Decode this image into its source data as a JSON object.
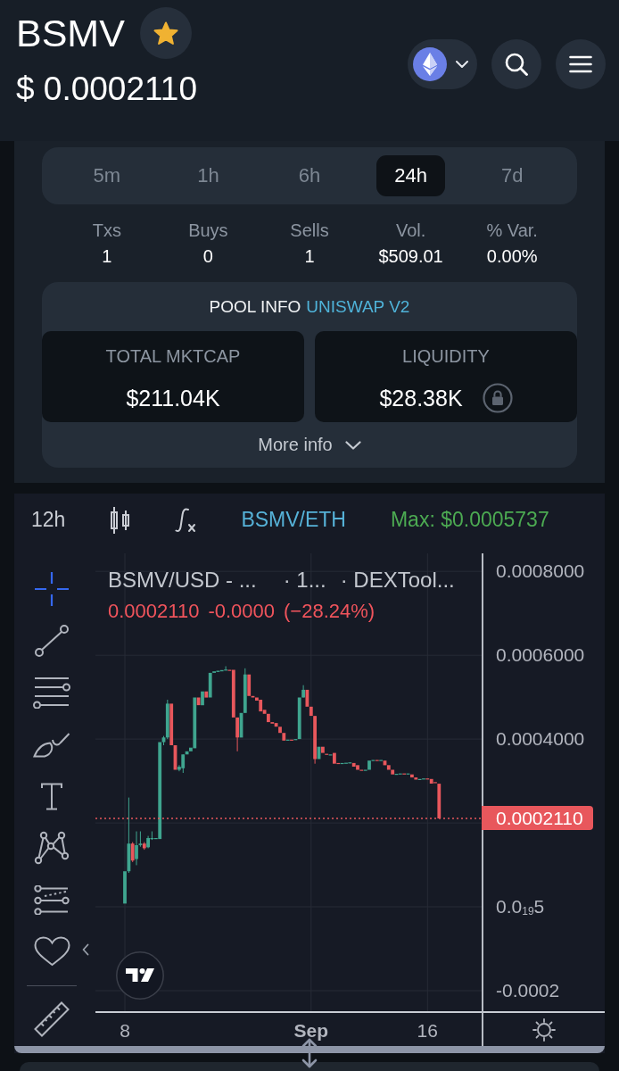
{
  "header": {
    "symbol": "BSMV",
    "starred": true,
    "price": "$ 0.0002110"
  },
  "timeframes": [
    {
      "label": "5m",
      "selected": false
    },
    {
      "label": "1h",
      "selected": false
    },
    {
      "label": "6h",
      "selected": false
    },
    {
      "label": "24h",
      "selected": true
    },
    {
      "label": "7d",
      "selected": false
    }
  ],
  "stats": [
    {
      "label": "Txs",
      "value": "1"
    },
    {
      "label": "Buys",
      "value": "0"
    },
    {
      "label": "Sells",
      "value": "1"
    },
    {
      "label": "Vol.",
      "value": "$509.01"
    },
    {
      "label": "% Var.",
      "value": "0.00%"
    }
  ],
  "pool_info": {
    "title": "POOL INFO",
    "exchange": "UNISWAP V2",
    "cards": [
      {
        "label": "TOTAL MKTCAP",
        "value": "$211.04K",
        "locked": false
      },
      {
        "label": "LIQUIDITY",
        "value": "$28.38K",
        "locked": true
      }
    ],
    "more_button": "More info"
  },
  "chart": {
    "interval": "12h",
    "pair": "BSMV/ETH",
    "max": "Max: $0.0005737",
    "tools": [
      {
        "selected": true
      },
      {
        "selected": false
      },
      {
        "selected": false
      },
      {
        "selected": false
      },
      {
        "selected": false
      },
      {
        "selected": false
      },
      {
        "selected": false
      },
      {
        "selected": false
      },
      {
        "selected": false
      }
    ],
    "legend": {
      "symbol": "BSMV/USD - ...",
      "interval": "· 1...",
      "source": "· DEXTool...",
      "last": "0.0002110",
      "change": "-0.0000",
      "change_percent": "(−28.24%)"
    },
    "zero_tick_label": "0.0$_{19}$5",
    "chart_data": {
      "type": "candlestick",
      "categories": [
        "8",
        null,
        null,
        null,
        null,
        null,
        null,
        null,
        null,
        null,
        null,
        null,
        null,
        null,
        null,
        null,
        null,
        null,
        null,
        null,
        null,
        null,
        null,
        null,
        null,
        null,
        null,
        null,
        null,
        null,
        null,
        null,
        null,
        null,
        null,
        null,
        null,
        null,
        null,
        null,
        null,
        null,
        null,
        null,
        null,
        null,
        null,
        null,
        "Sep",
        null,
        null,
        null,
        null,
        null,
        null,
        null,
        null,
        null,
        null,
        null,
        null,
        null,
        null,
        null,
        null,
        null,
        null,
        null,
        null,
        null,
        null,
        null,
        null,
        null,
        null,
        null,
        null,
        null,
        "16",
        null,
        null,
        null
      ],
      "ohlc": [
        [
          7.6e-06,
          8.47e-05,
          7.6e-06,
          8.47e-05
        ],
        [
          8.47e-05,
          0.0002607,
          8.1e-05,
          0.0001507
        ],
        [
          0.0001507,
          0.0001544,
          0.0001067,
          0.0001103
        ],
        [
          0.000114,
          0.00018,
          9.93e-05,
          0.000147
        ],
        [
          0.000147,
          0.00018,
          0.0001433,
          0.0001507
        ],
        [
          0.0001507,
          0.0001544,
          0.000136,
          0.0001397
        ],
        [
          0.0001419,
          0.000169,
          0.0001397,
          0.0001639
        ],
        [
          0.0001617,
          0.00018,
          0.0001595,
          0.0001639
        ],
        [
          0.0001624,
          0.0001639,
          0.0001624,
          0.0001639
        ],
        [
          0.0001617,
          0.0003928,
          0.0001617,
          0.0003928
        ],
        [
          0.0003928,
          0.0004075,
          0.0003854,
          0.0004038
        ],
        [
          0.0004038,
          0.000494,
          0.0004001,
          0.0004845
        ],
        [
          0.0004845,
          0.0004845,
          0.0003854,
          0.0003854
        ],
        [
          0.0003854,
          0.0003854,
          0.0003268,
          0.0003268
        ],
        [
          0.0003268,
          0.0003378,
          0.0003231,
          0.0003341
        ],
        [
          0.0003304,
          0.0003634,
          0.0003194,
          0.0003634
        ],
        [
          0.0003634,
          0.0003708,
          0.0003634,
          0.0003708
        ],
        [
          0.0003708,
          0.0003796,
          0.0003708,
          0.0003796
        ],
        [
          0.0003781,
          0.0004992,
          0.0003781,
          0.0004992
        ],
        [
          0.0004992,
          0.0004992,
          0.0004808,
          0.0004808
        ],
        [
          0.0004808,
          0.0005138,
          0.0004808,
          0.0005138
        ],
        [
          0.0005138,
          0.0005138,
          0.0004992,
          0.0004992
        ],
        [
          0.0004992,
          0.0005579,
          0.0004992,
          0.0005579
        ],
        [
          0.0005579,
          0.0005615,
          0.0005579,
          0.0005615
        ],
        [
          0.0005601,
          0.000563,
          0.0005601,
          0.000563
        ],
        [
          0.0005615,
          0.0005645,
          0.0005615,
          0.0005645
        ],
        [
          0.0005645,
          0.0005737,
          0.0005645,
          0.0005659
        ],
        [
          0.0005652,
          0.0005652,
          0.0005645,
          0.0005645
        ],
        [
          0.0005652,
          0.0005652,
          0.0004515,
          0.0004515
        ],
        [
          0.0004515,
          0.0004515,
          0.0003708,
          0.0004038
        ],
        [
          0.0004038,
          0.0004625,
          0.0004038,
          0.0004625
        ],
        [
          0.0004625,
          0.0005689,
          0.0004625,
          0.0005542
        ],
        [
          0.0005542,
          0.0005542,
          0.0005028,
          0.0005028
        ],
        [
          0.0005028,
          0.0005028,
          0.0004992,
          0.0004992
        ],
        [
          0.0004992,
          0.0004992,
          0.0004918,
          0.0004918
        ],
        [
          0.000494,
          0.000494,
          0.0004662,
          0.0004662
        ],
        [
          0.0004698,
          0.0004698,
          0.0004603,
          0.0004603
        ],
        [
          0.0004603,
          0.0004603,
          0.0004405,
          0.0004405
        ],
        [
          0.0004405,
          0.0004405,
          0.0004368,
          0.0004368
        ],
        [
          0.0004383,
          0.0004383,
          0.0004295,
          0.0004295
        ],
        [
          0.0004295,
          0.0004295,
          0.0004148,
          0.0004148
        ],
        [
          0.0004148,
          0.0004148,
          0.0003965,
          0.0003965
        ],
        [
          0.0003965,
          0.0003987,
          0.0003965,
          0.0003987
        ],
        [
          0.0003987,
          0.0003987,
          0.0003979,
          0.0003979
        ],
        [
          0.0003987,
          0.0004001,
          0.0003987,
          0.0004001
        ],
        [
          0.0004001,
          0.0004992,
          0.0004001,
          0.0004992
        ],
        [
          0.0004992,
          0.0005285,
          0.0004992,
          0.0005175
        ],
        [
          0.0005175,
          0.0005175,
          0.0004772,
          0.0004772
        ],
        [
          0.0004772,
          0.0004772,
          0.0004552,
          0.0004552
        ],
        [
          0.0004552,
          0.0004552,
          0.0003414,
          0.0003524
        ],
        [
          0.0003524,
          0.0003818,
          0.0003524,
          0.0003818
        ],
        [
          0.0003818,
          0.0003818,
          0.0003671,
          0.0003671
        ],
        [
          0.0003649,
          0.0003649,
          0.0003634,
          0.0003634
        ],
        [
          0.0003634,
          0.0003634,
          0.0003634,
          0.0003634
        ],
        [
          0.0003671,
          0.0003671,
          0.0003414,
          0.0003414
        ],
        [
          0.0003429,
          0.0003429,
          0.0003414,
          0.0003414
        ],
        [
          0.0003414,
          0.0003429,
          0.0003414,
          0.0003429
        ],
        [
          0.0003429,
          0.0003436,
          0.0003429,
          0.0003436
        ],
        [
          0.0003436,
          0.0003444,
          0.0003436,
          0.0003444
        ],
        [
          0.0003429,
          0.0003429,
          0.0003341,
          0.0003341
        ],
        [
          0.0003378,
          0.0003378,
          0.0003268,
          0.0003268
        ],
        [
          0.0003268,
          0.0003268,
          0.0003253,
          0.0003253
        ],
        [
          0.0003253,
          0.0003268,
          0.0003253,
          0.0003268
        ],
        [
          0.0003268,
          0.0003488,
          0.0003268,
          0.0003488
        ],
        [
          0.0003488,
          0.0003502,
          0.0003488,
          0.0003502
        ],
        [
          0.0003502,
          0.0003502,
          0.0003488,
          0.0003488
        ],
        [
          0.0003488,
          0.0003502,
          0.0003488,
          0.0003502
        ],
        [
          0.0003488,
          0.0003488,
          0.0003378,
          0.0003378
        ],
        [
          0.0003378,
          0.0003378,
          0.0003268,
          0.0003268
        ],
        [
          0.0003268,
          0.0003268,
          0.0003157,
          0.0003157
        ],
        [
          0.0003157,
          0.0003172,
          0.0003157,
          0.0003172
        ],
        [
          0.0003172,
          0.000318,
          0.0003172,
          0.000318
        ],
        [
          0.000318,
          0.000318,
          0.0003165,
          0.0003165
        ],
        [
          0.0003165,
          0.000318,
          0.0003165,
          0.000318
        ],
        [
          0.0003157,
          0.0003157,
          0.0003084,
          0.0003084
        ],
        [
          0.0003084,
          0.0003084,
          0.0003033,
          0.0003033
        ],
        [
          0.0003048,
          0.0003048,
          0.0003048,
          0.0003048
        ],
        [
          0.0003048,
          0.0003062,
          0.0003048,
          0.0003062
        ],
        [
          0.0003062,
          0.0003062,
          0.0003048,
          0.0003048
        ],
        [
          0.0003048,
          0.0003048,
          0.0002937,
          0.0002937
        ],
        [
          0.0002974,
          0.0002974,
          0.0002952,
          0.0002952
        ],
        [
          0.0002937,
          0.0002937,
          0.000211,
          0.000211
        ]
      ],
      "ylim": [
        -0.000249,
        0.000843
      ],
      "grid": true,
      "ref_lines": [
        {
          "axis": "y",
          "value": 0.000211,
          "label": "0.0002110",
          "color": "#e8575c"
        }
      ],
      "yticks": [
        {
          "value": 0.0008,
          "label": "0.0008000"
        },
        {
          "value": 0.0006,
          "label": "0.0006000"
        },
        {
          "value": 0.0004,
          "label": "0.0004000"
        },
        {
          "value": -0.0002,
          "label": "-0.0002"
        }
      ]
    }
  }
}
